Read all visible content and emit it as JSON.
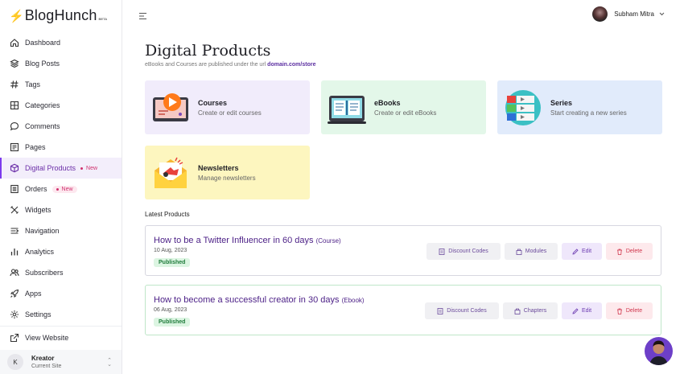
{
  "brand": {
    "name": "BlogHunch",
    "beta": "BETA",
    "accent": "#b4237a"
  },
  "sidebar": {
    "items": [
      {
        "label": "Dashboard",
        "icon": "home-icon"
      },
      {
        "label": "Blog Posts",
        "icon": "layers-icon"
      },
      {
        "label": "Tags",
        "icon": "hash-icon"
      },
      {
        "label": "Categories",
        "icon": "grid-icon"
      },
      {
        "label": "Comments",
        "icon": "comment-icon"
      },
      {
        "label": "Pages",
        "icon": "page-icon"
      },
      {
        "label": "Digital Products",
        "icon": "box-icon",
        "badge": "New",
        "active": true
      },
      {
        "label": "Orders",
        "icon": "list-icon",
        "badge": "New"
      },
      {
        "label": "Widgets",
        "icon": "tools-icon"
      },
      {
        "label": "Navigation",
        "icon": "navigation-icon"
      },
      {
        "label": "Analytics",
        "icon": "bar-chart-icon"
      },
      {
        "label": "Subscribers",
        "icon": "users-icon"
      },
      {
        "label": "Apps",
        "icon": "rocket-icon"
      },
      {
        "label": "Settings",
        "icon": "gear-icon"
      }
    ],
    "view_website": "View Website",
    "site": {
      "initial": "K",
      "name": "Kreator",
      "sub": "Current Site"
    }
  },
  "topbar": {
    "user_name": "Subham Mitra"
  },
  "main": {
    "title": "Digital Products",
    "subtitle_prefix": "eBooks and Courses are published under the url",
    "subtitle_url": "domain.com/store",
    "cards": [
      {
        "title": "Courses",
        "desc": "Create or edit courses",
        "color": "#f1ecfb"
      },
      {
        "title": "eBooks",
        "desc": "Create or edit eBooks",
        "color": "#e3f7e9"
      },
      {
        "title": "Series",
        "desc": "Start creating a new series",
        "color": "#e1ebfb"
      },
      {
        "title": "Newsletters",
        "desc": "Manage newsletters",
        "color": "#fdf6bf"
      }
    ],
    "latest_label": "Latest Products",
    "products": [
      {
        "title": "How to be a Twitter Influencer in 60 days",
        "type": "(Course)",
        "date": "10 Aug, 2023",
        "status": "Published",
        "actions": [
          "Discount Codes",
          "Modules",
          "Edit",
          "Delete"
        ]
      },
      {
        "title": "How to become a successful creator in 30 days",
        "type": "(Ebook)",
        "date": "06 Aug, 2023",
        "status": "Published",
        "actions": [
          "Discount Codes",
          "Chapters",
          "Edit",
          "Delete"
        ]
      }
    ]
  }
}
